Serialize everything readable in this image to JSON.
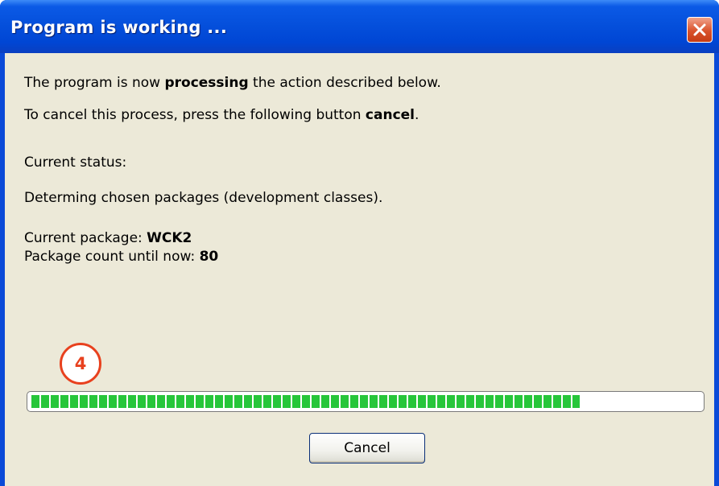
{
  "window": {
    "title": "Program is working ..."
  },
  "message": {
    "line1": {
      "pre": "The program is now ",
      "bold": "processing",
      "post": " the action described below."
    },
    "line2": {
      "pre": "To cancel this process, press the following button ",
      "bold": "cancel",
      "post": "."
    }
  },
  "status": {
    "label": "Current status:",
    "description": "Determing chosen packages (development classes).",
    "current_package": {
      "label": "Current package: ",
      "value": "WCK2"
    },
    "package_count": {
      "label": "Package count until now: ",
      "value": "80"
    }
  },
  "annotation": {
    "badge_number": "4"
  },
  "progress": {
    "fraction": 0.82,
    "color": "#27c63a"
  },
  "buttons": {
    "cancel_label": "Cancel"
  },
  "icons": {
    "close": "close-icon"
  },
  "colors": {
    "titlebar": "#0550dc",
    "client_bg": "#ece9d8",
    "close_button": "#d9522b",
    "badge": "#e8411e"
  }
}
